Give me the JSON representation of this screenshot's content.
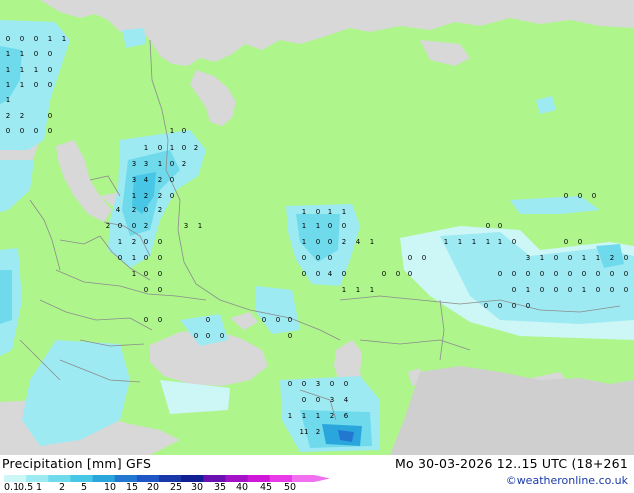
{
  "map": {
    "region": "Europe / Western Russia",
    "colors": {
      "land": "#aef58c",
      "sea": "#d8d8d8",
      "out_of_domain_land": "#cfcfcf",
      "border": "#8c8c8c"
    },
    "precip_labels": [
      "0",
      "0",
      "0",
      "1",
      "1",
      "1",
      "1",
      "0",
      "0",
      "1",
      "1",
      "1",
      "0",
      "1",
      "1",
      "0",
      "0",
      "1",
      "2",
      "2",
      "0",
      "0",
      "0",
      "0",
      "0",
      "1",
      "0",
      "1",
      "0",
      "1",
      "0",
      "2",
      "3",
      "3",
      "1",
      "0",
      "2",
      "3",
      "4",
      "2",
      "0",
      "1",
      "2",
      "2",
      "0",
      "4",
      "2",
      "0",
      "2",
      "2",
      "0",
      "0",
      "2",
      "3",
      "1",
      "1",
      "2",
      "0",
      "0",
      "0",
      "1",
      "0",
      "0",
      "1",
      "0",
      "0",
      "0",
      "0",
      "0",
      "0",
      "0",
      "0",
      "0",
      "0",
      "0",
      "0",
      "0",
      "0",
      "1",
      "0",
      "1",
      "1",
      "1",
      "1",
      "0",
      "0",
      "1",
      "0",
      "0",
      "2",
      "4",
      "1",
      "0",
      "0",
      "0",
      "0",
      "0",
      "4",
      "0",
      "1",
      "1",
      "1",
      "0",
      "0",
      "0",
      "0",
      "0",
      "1",
      "1",
      "1",
      "1",
      "1",
      "0",
      "0",
      "0",
      "0",
      "0",
      "0",
      "0",
      "0",
      "3",
      "1",
      "0",
      "0",
      "1",
      "1",
      "2",
      "0",
      "0",
      "0",
      "0",
      "0",
      "0",
      "0",
      "0",
      "0",
      "0",
      "0",
      "0",
      "1",
      "0",
      "0",
      "0",
      "1",
      "0",
      "0",
      "0",
      "0",
      "0",
      "0",
      "0",
      "0",
      "0",
      "3",
      "0",
      "0",
      "0",
      "0",
      "3",
      "4",
      "1",
      "1",
      "1",
      "2",
      "6",
      "11",
      "2"
    ]
  },
  "footer": {
    "title": "Precipitation [mm] GFS",
    "datetime": "Mo 30-03-2026 12..15 UTC (18+261",
    "credit": "©weatheronline.co.uk"
  },
  "scale": {
    "labels": [
      "0.1",
      "0.5",
      "1",
      "2",
      "5",
      "10",
      "15",
      "20",
      "25",
      "30",
      "35",
      "40",
      "45",
      "50"
    ],
    "colors": [
      "#cdf6f6",
      "#9eeaf3",
      "#6fdaec",
      "#47c6e6",
      "#2aa6dc",
      "#2278d0",
      "#1f55c4",
      "#1838a8",
      "#102092",
      "#6a10b0",
      "#a412c8",
      "#d016d6",
      "#e83ae6",
      "#f070f0"
    ]
  }
}
